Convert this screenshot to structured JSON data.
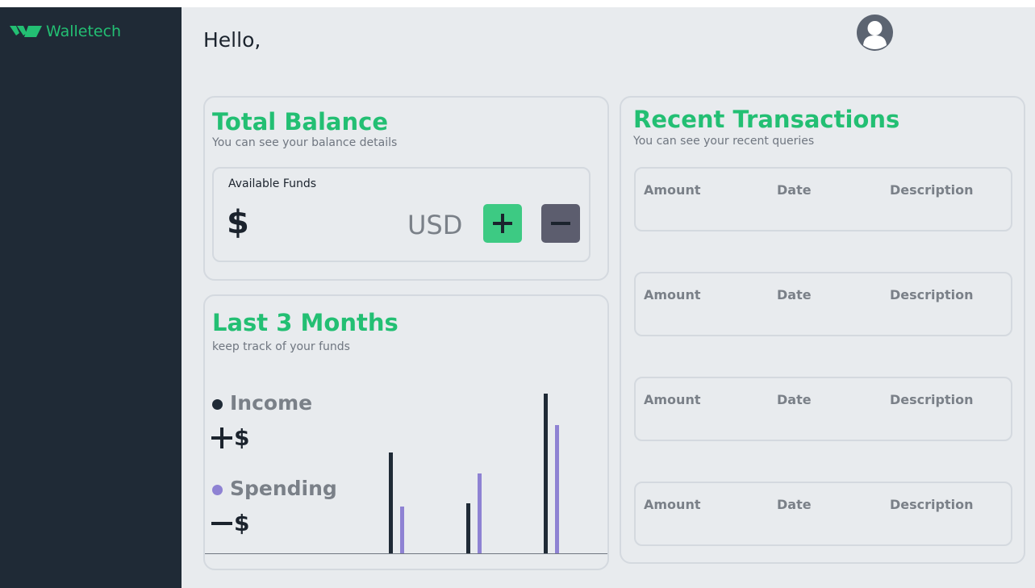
{
  "app": {
    "name": "Walletech",
    "brand_color": "#23bf73",
    "sidebar_color": "#1f2a36"
  },
  "header": {
    "greeting": "Hello,",
    "avatar_icon": "user-avatar-icon"
  },
  "balance": {
    "title": "Total Balance",
    "subtitle": "You can see your balance details",
    "funds_label": "Available Funds",
    "currency_symbol": "$",
    "currency_code": "USD",
    "add_icon": "plus-icon",
    "remove_icon": "minus-icon"
  },
  "months": {
    "title": "Last 3 Months",
    "subtitle": "keep track of your funds",
    "income_label": "Income",
    "income_amount": "$",
    "spending_label": "Spending",
    "spending_amount": "$",
    "income_color": "#1f2a36",
    "spending_color": "#8e82d3"
  },
  "chart_data": {
    "type": "bar",
    "categories": [
      "",
      "",
      ""
    ],
    "series": [
      {
        "name": "Income",
        "values": [
          125,
          62,
          198
        ]
      },
      {
        "name": "Spending",
        "values": [
          58,
          99,
          159
        ]
      }
    ],
    "ylim": [
      0,
      200
    ],
    "grid": false
  },
  "transactions": {
    "title": "Recent Transactions",
    "subtitle": "You can see your recent queries",
    "rows": [
      {
        "amount": "Amount",
        "date": "Date",
        "description": "Description"
      },
      {
        "amount": "Amount",
        "date": "Date",
        "description": "Description"
      },
      {
        "amount": "Amount",
        "date": "Date",
        "description": "Description"
      },
      {
        "amount": "Amount",
        "date": "Date",
        "description": "Description"
      }
    ]
  }
}
